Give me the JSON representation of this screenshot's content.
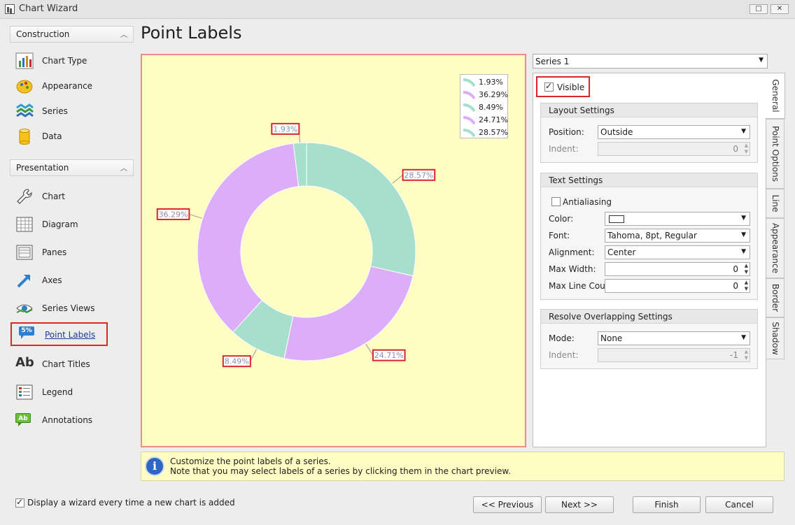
{
  "window": {
    "title": "Chart Wizard",
    "restore_glyph": "□",
    "close_glyph": "✕"
  },
  "sidebar": {
    "groups": [
      {
        "label": "Construction",
        "items": [
          {
            "label": "Chart Type",
            "icon": "chart-type-icon"
          },
          {
            "label": "Appearance",
            "icon": "appearance-icon"
          },
          {
            "label": "Series",
            "icon": "series-icon"
          },
          {
            "label": "Data",
            "icon": "data-icon"
          }
        ]
      },
      {
        "label": "Presentation",
        "items": [
          {
            "label": "Chart",
            "icon": "wrench-icon"
          },
          {
            "label": "Diagram",
            "icon": "diagram-icon"
          },
          {
            "label": "Panes",
            "icon": "panes-icon"
          },
          {
            "label": "Axes",
            "icon": "axes-icon"
          },
          {
            "label": "Series Views",
            "icon": "series-views-icon"
          },
          {
            "label": "Point Labels",
            "icon": "point-labels-icon",
            "selected": true,
            "badge": "5%"
          },
          {
            "label": "Chart Titles",
            "icon": "chart-titles-icon",
            "glyph": "Ab"
          },
          {
            "label": "Legend",
            "icon": "legend-icon"
          },
          {
            "label": "Annotations",
            "icon": "annotations-icon",
            "glyph": "Ab"
          }
        ]
      }
    ]
  },
  "page_title": "Point Labels",
  "chart_data": {
    "type": "pie",
    "variant": "doughnut",
    "values": [
      28.57,
      24.71,
      8.49,
      36.29,
      1.93
    ],
    "labels": [
      "28.57%",
      "24.71%",
      "8.49%",
      "36.29%",
      "1.93%"
    ],
    "colors": [
      "#a6e0cc",
      "#dcaef8",
      "#a6e0cc",
      "#dcaef8",
      "#a6e0cc"
    ],
    "start_angle_deg": 90,
    "direction": "clockwise",
    "legend": {
      "position": "top-right",
      "entries": [
        {
          "label": "1.93%",
          "color": "#a6e0cc"
        },
        {
          "label": "36.29%",
          "color": "#dcaef8"
        },
        {
          "label": "8.49%",
          "color": "#a6e0cc"
        },
        {
          "label": "24.71%",
          "color": "#dcaef8"
        },
        {
          "label": "28.57%",
          "color": "#a6e0cc"
        }
      ]
    },
    "background": "#fffcc4",
    "label_border_color": "#d9262b"
  },
  "series_selector": {
    "value": "Series 1"
  },
  "tabs": [
    "General",
    "Point Options",
    "Line",
    "Appearance",
    "Border",
    "Shadow"
  ],
  "general": {
    "visible_label": "Visible",
    "visible_checked": true,
    "layout": {
      "title": "Layout Settings",
      "position_label": "Position:",
      "position_value": "Outside",
      "indent_label": "Indent:",
      "indent_value": "0"
    },
    "text": {
      "title": "Text Settings",
      "antialiasing_label": "Antialiasing",
      "antialiasing_checked": false,
      "color_label": "Color:",
      "color_value": "#ffffff",
      "font_label": "Font:",
      "font_value": "Tahoma, 8pt, Regular",
      "alignment_label": "Alignment:",
      "alignment_value": "Center",
      "max_width_label": "Max Width:",
      "max_width_value": "0",
      "max_line_count_label": "Max Line Count:",
      "max_line_count_value": "0"
    },
    "resolve": {
      "title": "Resolve Overlapping Settings",
      "mode_label": "Mode:",
      "mode_value": "None",
      "indent_label": "Indent:",
      "indent_value": "-1"
    }
  },
  "info": {
    "line1": "Customize the point labels of a series.",
    "line2": "Note that you may select labels of a series by clicking them in the chart preview."
  },
  "footer": {
    "wizard_checkbox_label": "Display a wizard every time a new chart is added",
    "wizard_checked": true,
    "previous": "<< Previous",
    "next": "Next >>",
    "finish": "Finish",
    "cancel": "Cancel"
  },
  "icons": {
    "dropdown": "▼",
    "spin_up": "▲",
    "spin_down": "▼",
    "collapse": "︿",
    "info": "i"
  }
}
